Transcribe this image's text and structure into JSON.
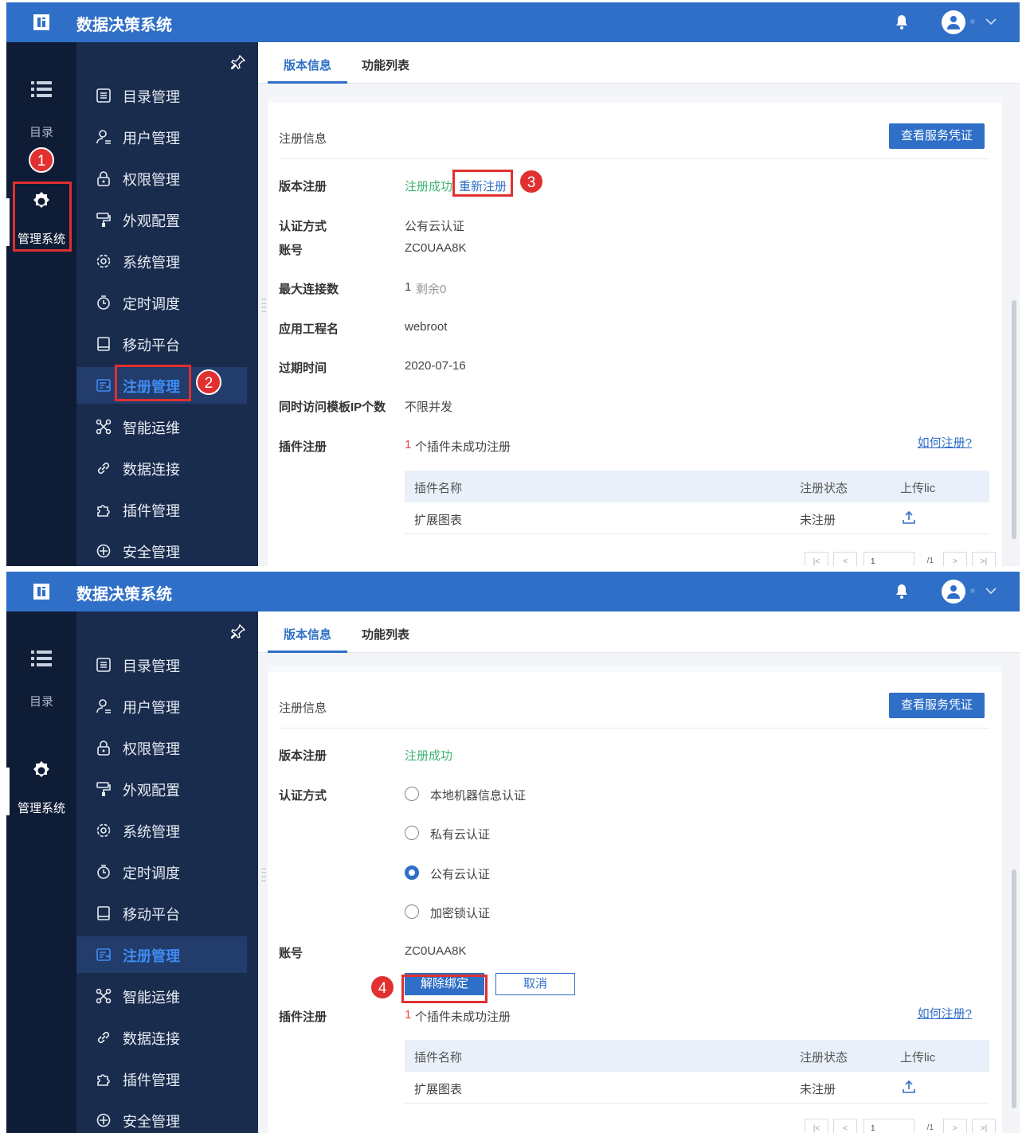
{
  "app": {
    "title": "数据决策系统"
  },
  "rail": {
    "catalog_label": "目录",
    "admin_label": "管理系统"
  },
  "sidebar": {
    "items": [
      {
        "label": "目录管理"
      },
      {
        "label": "用户管理"
      },
      {
        "label": "权限管理"
      },
      {
        "label": "外观配置"
      },
      {
        "label": "系统管理"
      },
      {
        "label": "定时调度"
      },
      {
        "label": "移动平台"
      },
      {
        "label": "注册管理"
      },
      {
        "label": "智能运维"
      },
      {
        "label": "数据连接"
      },
      {
        "label": "插件管理"
      },
      {
        "label": "安全管理"
      }
    ]
  },
  "tabs": {
    "version_info": "版本信息",
    "feature_list": "功能列表"
  },
  "registration": {
    "section_title": "注册信息",
    "view_credential_button": "查看服务凭证",
    "version_reg_label": "版本注册",
    "reg_success": "注册成功",
    "re_register": "重新注册",
    "auth_label": "认证方式",
    "auth_value": "公有云认证",
    "account_label": "账号",
    "account_value": "ZC0UAA8K",
    "max_conn_label": "最大连接数",
    "max_conn_value": "1",
    "max_conn_remaining": "剩余0",
    "app_name_label": "应用工程名",
    "app_name_value": "webroot",
    "expire_label": "过期时间",
    "expire_value": "2020-07-16",
    "ip_label": "同时访问模板IP个数",
    "ip_value": "不限并发",
    "plugin_label": "插件注册",
    "plugin_fail_count": "1",
    "plugin_fail_text": "个插件未成功注册",
    "how_to_register": "如何注册?",
    "table_headers": [
      "插件名称",
      "注册状态",
      "上传lic"
    ],
    "table_rows": [
      {
        "name": "扩展图表",
        "status": "未注册"
      }
    ],
    "pager_page": "1",
    "pager_total": "/1",
    "auth_options": [
      "本地机器信息认证",
      "私有云认证",
      "公有云认证",
      "加密锁认证"
    ],
    "auth_selected": "公有云认证",
    "unbind_button": "解除绑定",
    "cancel_button": "取消"
  },
  "annotations": {
    "step1": "1",
    "step2": "2",
    "step3": "3",
    "step4": "4"
  },
  "colors": {
    "primary": "#2f6fc7",
    "sidebar": "#1a2c4d",
    "rail": "#0e1c36",
    "success": "#3cb371",
    "marker": "#e0302f"
  }
}
